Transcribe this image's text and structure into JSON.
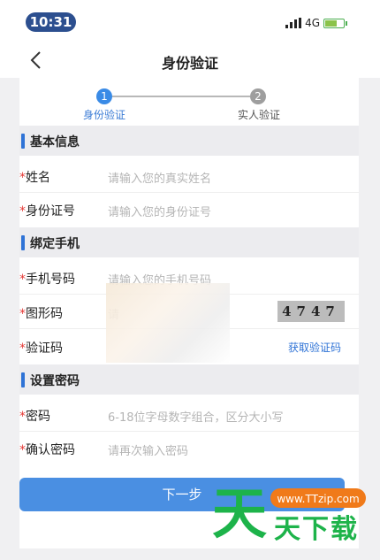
{
  "status_bar": {
    "time": "10:31",
    "network": "4G"
  },
  "nav": {
    "title": "身份验证"
  },
  "steps": [
    {
      "number": "1",
      "label": "身份验证"
    },
    {
      "number": "2",
      "label": "实人验证"
    }
  ],
  "sections": {
    "basic": "基本信息",
    "phone": "绑定手机",
    "password": "设置密码"
  },
  "fields": {
    "name": {
      "required": "*",
      "label": "姓名",
      "placeholder": "请输入您的真实姓名"
    },
    "id_number": {
      "required": "*",
      "label": "身份证号",
      "placeholder": "请输入您的身份证号"
    },
    "phone": {
      "required": "*",
      "label": "手机号码",
      "placeholder": "请输入您的手机号码"
    },
    "captcha": {
      "required": "*",
      "label": "图形码",
      "placeholder": "请",
      "captcha_text": "4747"
    },
    "sms_code": {
      "required": "*",
      "label": "验证码",
      "action": "获取验证码"
    },
    "password": {
      "required": "*",
      "label": "密码",
      "placeholder": "6-18位字母数字组合，区分大小写"
    },
    "confirm_password": {
      "required": "*",
      "label": "确认密码",
      "placeholder": "请再次输入密码"
    }
  },
  "actions": {
    "next": "下一步"
  },
  "watermark": {
    "url": "www.TTzip.com",
    "big": "天",
    "text": "天下载"
  },
  "colors": {
    "accent": "#2f73d6",
    "button": "#4a8fe2",
    "required": "#e53935",
    "watermark": "#1db34a"
  }
}
